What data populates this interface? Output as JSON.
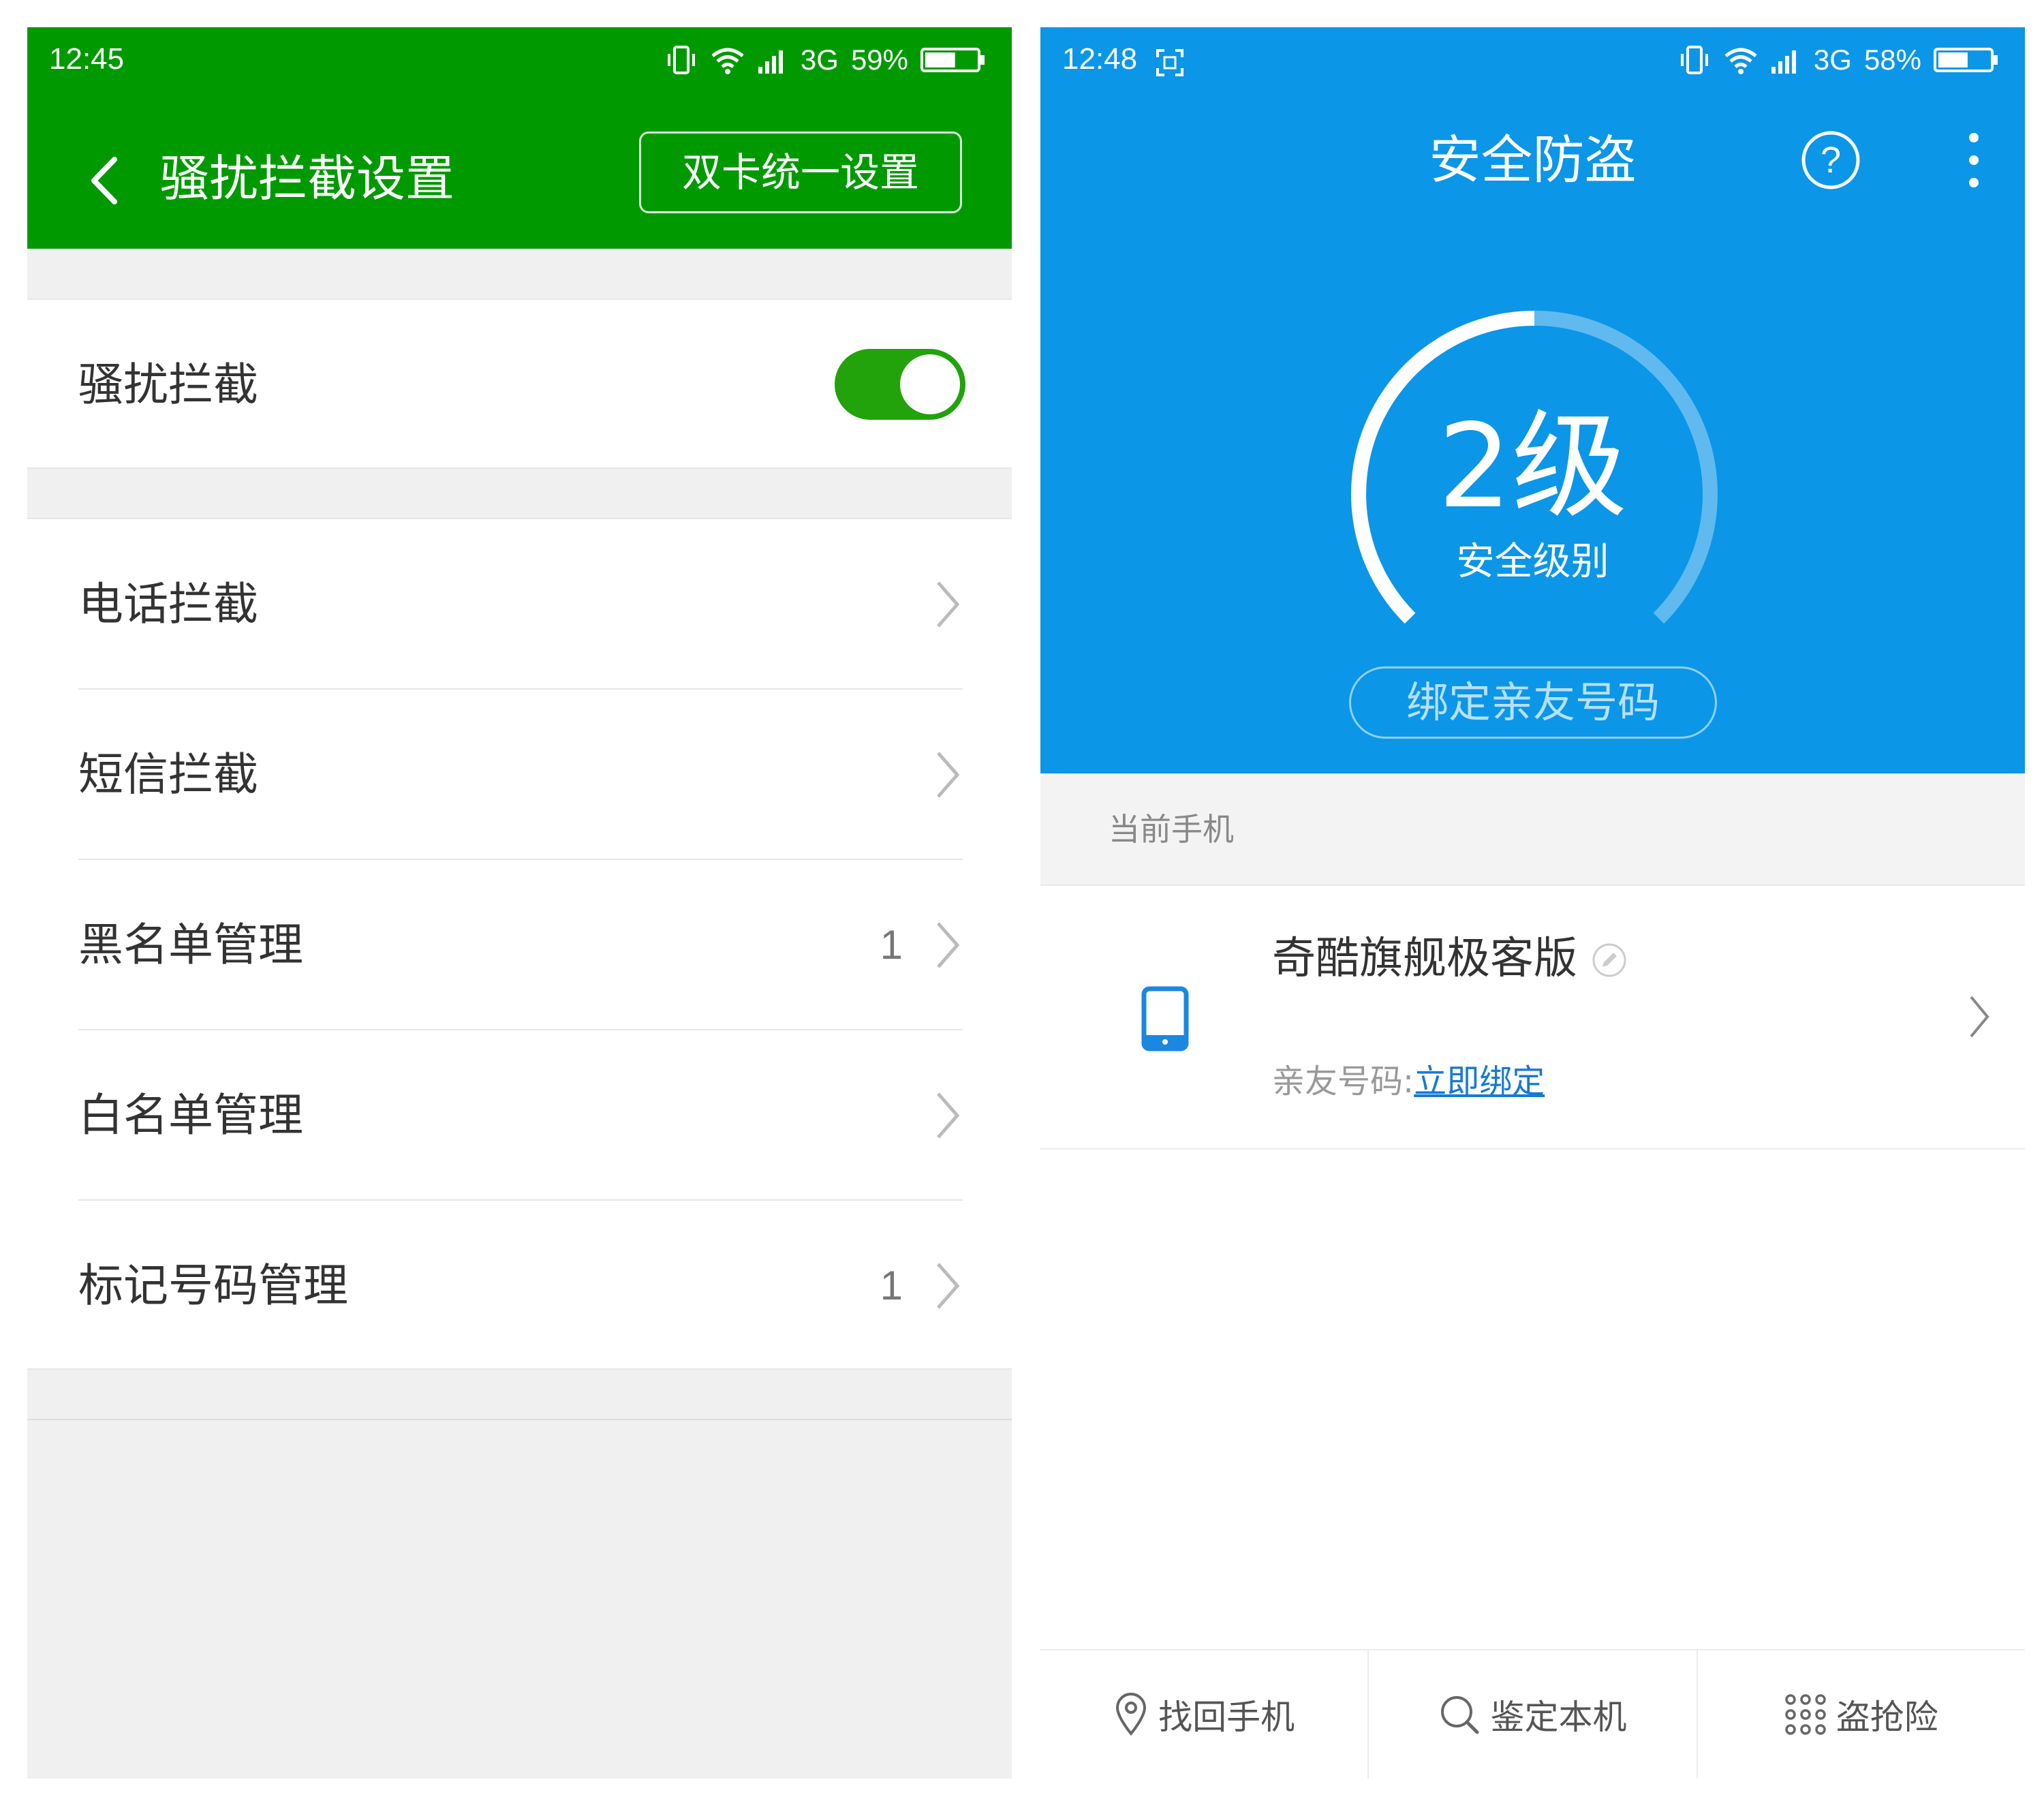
{
  "left": {
    "status": {
      "time": "12:45",
      "network": "3G",
      "battery": "59%",
      "battery_level": 0.59
    },
    "header": {
      "title": "骚扰拦截设置",
      "dual_sim_button": "双卡统一设置"
    },
    "toggle_row": {
      "label": "骚扰拦截",
      "enabled": true
    },
    "rows": [
      {
        "label": "电话拦截",
        "count": ""
      },
      {
        "label": "短信拦截",
        "count": ""
      },
      {
        "label": "黑名单管理",
        "count": "1"
      },
      {
        "label": "白名单管理",
        "count": ""
      },
      {
        "label": "标记号码管理",
        "count": "1"
      }
    ],
    "colors": {
      "header": "#009a00",
      "toggle_on": "#22a20b"
    }
  },
  "right": {
    "status": {
      "time": "12:48",
      "network": "3G",
      "battery": "58%",
      "battery_level": 0.58
    },
    "header": {
      "title": "安全防盗"
    },
    "gauge": {
      "level_text": "2级",
      "label": "安全级别",
      "fraction": 0.5
    },
    "bind_button": "绑定亲友号码",
    "section_title": "当前手机",
    "device": {
      "name": "奇酷旗舰极客版",
      "friend_label": "亲友号码:",
      "friend_link": "立即绑定"
    },
    "nav": [
      {
        "label": "找回手机",
        "icon": "location-pin-icon"
      },
      {
        "label": "鉴定本机",
        "icon": "search-icon"
      },
      {
        "label": "盗抢险",
        "icon": "grid-icon"
      }
    ],
    "colors": {
      "header": "#0b96e8",
      "link": "#1779d4"
    }
  }
}
